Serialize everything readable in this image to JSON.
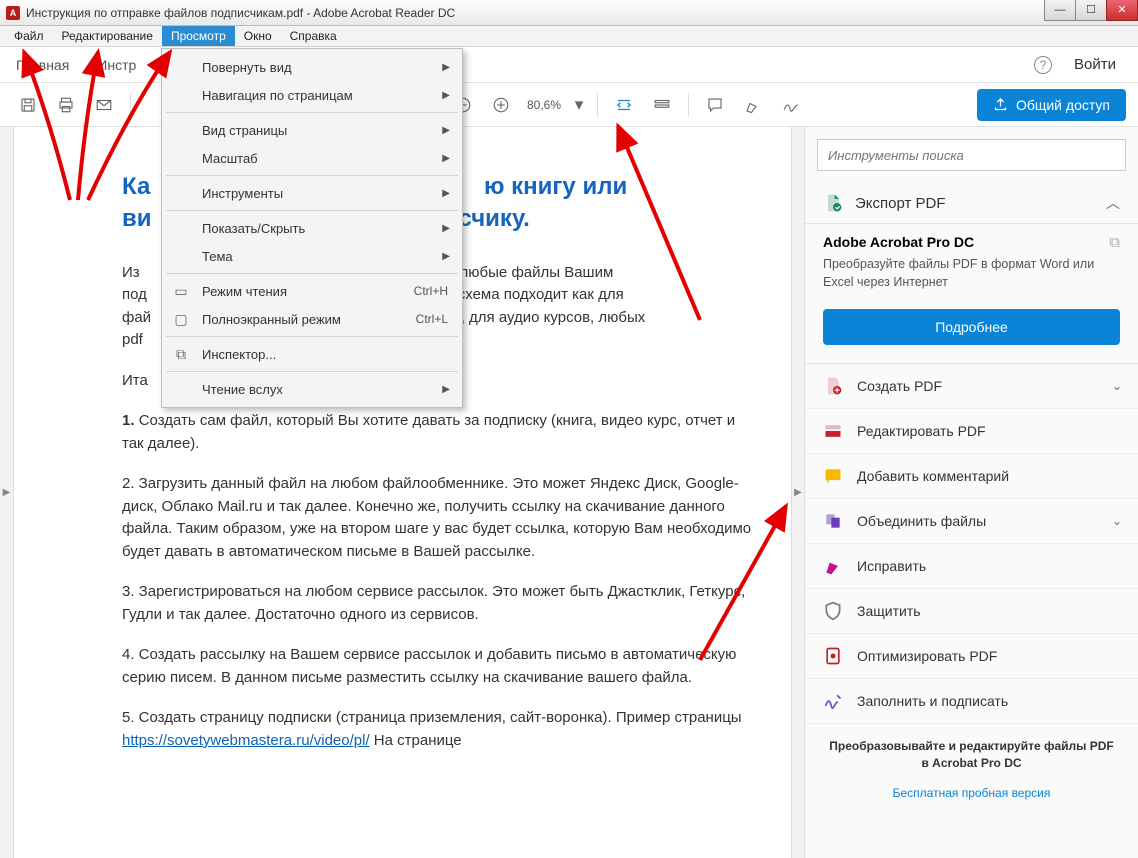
{
  "window": {
    "title": "Инструкция по отправке файлов подписчикам.pdf - Adobe Acrobat Reader DC"
  },
  "menubar": [
    "Файл",
    "Редактирование",
    "Просмотр",
    "Окно",
    "Справка"
  ],
  "menubar_active_index": 2,
  "subtoolbar": {
    "home": "Главная",
    "tools": "Инстр",
    "login": "Войти"
  },
  "toolbar": {
    "zoom": "80,6%",
    "share": "Общий доступ"
  },
  "view_menu": [
    {
      "label": "Повернуть вид",
      "arrow": true,
      "underline": 1
    },
    {
      "label": "Навигация по страницам",
      "arrow": true
    },
    "sep",
    {
      "label": "Вид страницы",
      "arrow": true
    },
    {
      "label": "Масштаб",
      "arrow": true
    },
    "sep",
    {
      "label": "Инструменты",
      "arrow": true
    },
    "sep",
    {
      "label": "Показать/Скрыть",
      "arrow": true
    },
    {
      "label": "Тема",
      "arrow": true
    },
    "sep",
    {
      "label": "Режим чтения",
      "shortcut": "Ctrl+H",
      "icon": "▭"
    },
    {
      "label": "Полноэкранный режим",
      "shortcut": "Ctrl+L",
      "icon": "▢"
    },
    "sep",
    {
      "label": "Инспектор...",
      "icon": "⧉"
    },
    "sep",
    {
      "label": "Чтение вслух",
      "arrow": true
    }
  ],
  "document": {
    "title_line1": "Ка",
    "title_line1_suffix": "ю книгу или",
    "title_line2_prefix": "ви",
    "title_line2_suffix": "счику.",
    "p_intro_prefix": "Из ",
    "p_intro_suffix1": "лять любые файлы Вашим",
    "p_intro_suffix2": "есть, схема подходит как для",
    "p_intro_suffix3": "урсов, для аудио курсов, любых",
    "p_intro_line2": "под",
    "p_intro_line3": "фай",
    "p_intro_line4": "pdf",
    "p_1": "Ита",
    "p_1_full": "1. Создать сам файл, который Вы хотите давать за подписку (книга, видео курс, отчет и так далее).",
    "p_2": "2. Загрузить данный файл на любом файлообменнике. Это может Яндекс Диск, Google-диск, Облако Mail.ru и так далее. Конечно же, получить ссылку на скачивание данного файла. Таким образом, уже на втором шаге у вас будет ссылка, которую Вам необходимо будет давать в автоматическом письме в Вашей рассылке.",
    "p_3": "3. Зарегистрироваться на любом сервисе рассылок. Это может быть Джастклик, Геткурс, Гудли и так далее. Достаточно одного из сервисов.",
    "p_4": "4. Создать рассылку на Вашем сервисе рассылок и добавить письмо в автоматическую серию писем. В данном письме разместить ссылку на скачивание вашего файла.",
    "p_5_a": "5. Создать страницу подписки (страница приземления, сайт-воронка). Пример страницы ",
    "p_5_link": "https://sovetywebmastera.ru/video/pl/",
    "p_5_b": " На странице"
  },
  "rightpanel": {
    "search_placeholder": "Инструменты поиска",
    "export_title": "Экспорт PDF",
    "pro_title": "Adobe Acrobat Pro DC",
    "pro_desc": "Преобразуйте файлы PDF в формат Word или Excel через Интернет",
    "more_btn": "Подробнее",
    "tools": [
      {
        "label": "Создать PDF",
        "color": "#c31f2e",
        "chev": true,
        "icon": "create"
      },
      {
        "label": "Редактировать PDF",
        "color": "#c31f2e",
        "icon": "edit"
      },
      {
        "label": "Добавить комментарий",
        "color": "#f6b800",
        "icon": "comment"
      },
      {
        "label": "Объединить файлы",
        "color": "#6a3fb5",
        "chev": true,
        "icon": "combine"
      },
      {
        "label": "Исправить",
        "color": "#c7138b",
        "icon": "fix"
      },
      {
        "label": "Защитить",
        "color": "#7a7a7a",
        "icon": "protect"
      },
      {
        "label": "Оптимизировать PDF",
        "color": "#c31f2e",
        "icon": "optimize"
      },
      {
        "label": "Заполнить и подписать",
        "color": "#7646c3",
        "icon": "sign"
      }
    ],
    "promo": "Преобразовывайте и редактируйте файлы PDF в Acrobat Pro DC",
    "trial": "Бесплатная пробная версия"
  }
}
